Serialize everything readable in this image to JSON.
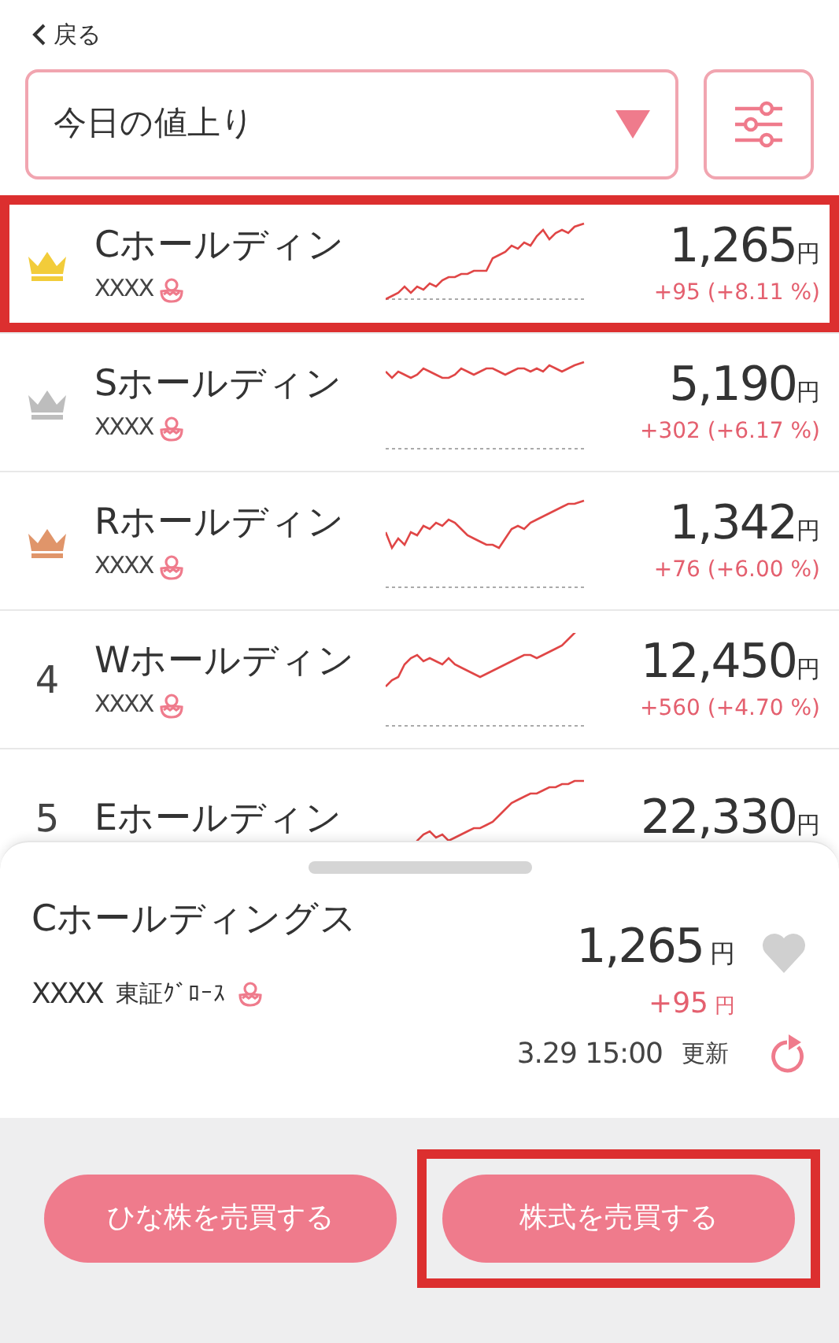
{
  "back": {
    "label": "戻る"
  },
  "sort_dropdown": {
    "value": "今日の値上り"
  },
  "rows": [
    {
      "kind": "crown",
      "color": "#f2cc3a",
      "name": "Cホールディン",
      "code": "XXXX",
      "price": "1,265",
      "unit": "円",
      "change": "+95 (+8.11 %)",
      "highlighted": true
    },
    {
      "kind": "crown",
      "color": "#bdbdbd",
      "name": "Sホールディン",
      "code": "XXXX",
      "price": "5,190",
      "unit": "円",
      "change": "+302 (+6.17 %)",
      "highlighted": false
    },
    {
      "kind": "crown",
      "color": "#e0956a",
      "name": "Rホールディン",
      "code": "XXXX",
      "price": "1,342",
      "unit": "円",
      "change": "+76 (+6.00 %)",
      "highlighted": false
    },
    {
      "kind": "number",
      "rank": "4",
      "name": "Wホールディン",
      "code": "XXXX",
      "price": "12,450",
      "unit": "円",
      "change": "+560 (+4.70 %)",
      "highlighted": false
    },
    {
      "kind": "number",
      "rank": "5",
      "name": "Eホールディン",
      "price": "22,330",
      "unit": "円",
      "highlighted": false
    }
  ],
  "detail": {
    "name": "Cホールディングス",
    "price": "1,265",
    "price_unit": "円",
    "code": "XXXX",
    "market": "東証ｸﾞﾛｰｽ",
    "change": "+95",
    "change_unit": "円",
    "favorite": false,
    "updated_time": "3.29 15:00",
    "updated_label": "更新"
  },
  "buttons": [
    {
      "label": "ひな株を売買する",
      "highlighted": false
    },
    {
      "label": "株式を売買する",
      "highlighted": true
    }
  ]
}
